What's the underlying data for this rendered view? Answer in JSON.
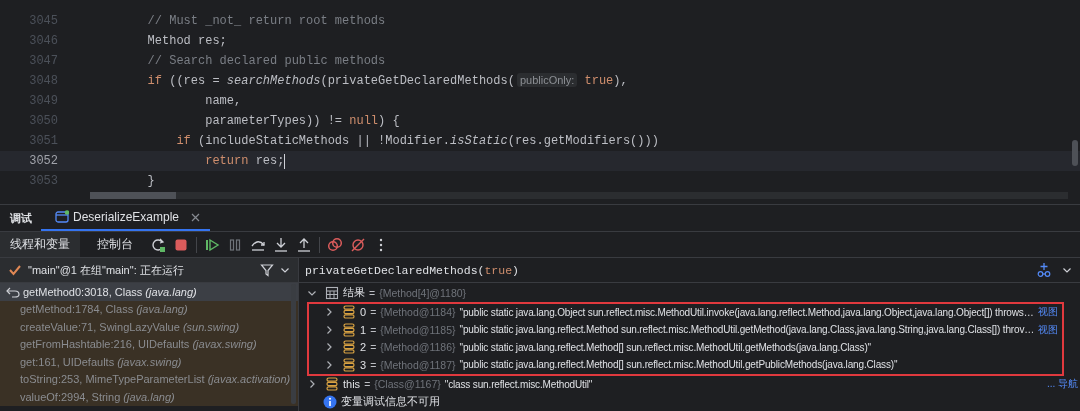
{
  "editor": {
    "lines": [
      {
        "number": "3045",
        "current": false,
        "tokens": [
          {
            "kind": "comment",
            "text": "        // Must _not_ return root methods"
          }
        ]
      },
      {
        "number": "3046",
        "current": false,
        "tokens": [
          {
            "kind": "plain",
            "text": "        Method res;"
          }
        ]
      },
      {
        "number": "3047",
        "current": false,
        "tokens": [
          {
            "kind": "comment",
            "text": "        // Search declared public methods"
          }
        ]
      },
      {
        "number": "3048",
        "current": false,
        "tokens": [
          {
            "kind": "keyword",
            "text": "        if"
          },
          {
            "kind": "plain",
            "text": " ((res = "
          },
          {
            "kind": "italic",
            "text": "searchMethods"
          },
          {
            "kind": "plain",
            "text": "(privateGetDeclaredMethods("
          },
          {
            "kind": "hint",
            "text": "publicOnly:"
          },
          {
            "kind": "keyword",
            "text": " true"
          },
          {
            "kind": "plain",
            "text": "),"
          }
        ]
      },
      {
        "number": "3049",
        "current": false,
        "tokens": [
          {
            "kind": "plain",
            "text": "                name,"
          }
        ]
      },
      {
        "number": "3050",
        "current": false,
        "tokens": [
          {
            "kind": "plain",
            "text": "                parameterTypes)) != "
          },
          {
            "kind": "keyword",
            "text": "null"
          },
          {
            "kind": "plain",
            "text": ") {"
          }
        ]
      },
      {
        "number": "3051",
        "current": false,
        "tokens": [
          {
            "kind": "keyword",
            "text": "            if"
          },
          {
            "kind": "plain",
            "text": " (includeStaticMethods || !Modifier."
          },
          {
            "kind": "italic",
            "text": "isStatic"
          },
          {
            "kind": "plain",
            "text": "(res.getModifiers()))"
          }
        ]
      },
      {
        "number": "3052",
        "current": true,
        "tokens": [
          {
            "kind": "keyword",
            "text": "                return"
          },
          {
            "kind": "plain",
            "text": " res;"
          }
        ]
      },
      {
        "number": "3053",
        "current": false,
        "tokens": [
          {
            "kind": "plain",
            "text": "        }"
          }
        ]
      }
    ]
  },
  "debug_window": {
    "title": "调试",
    "tabs": [
      {
        "label": "DeserializeExample",
        "selected": true,
        "closable": true
      }
    ]
  },
  "debugger_tabs": [
    {
      "label": "线程和变量",
      "selected": true
    },
    {
      "label": "控制台",
      "selected": false
    }
  ],
  "thread": {
    "label": "\"main\"@1 在组\"main\": 正在运行"
  },
  "frames": [
    {
      "method": "getMethod0:3018, Class",
      "package": "(java.lang)",
      "selected": true
    },
    {
      "method": "getMethod:1784, Class",
      "package": "(java.lang)",
      "selected": false
    },
    {
      "method": "createValue:71, SwingLazyValue",
      "package": "(sun.swing)",
      "selected": false
    },
    {
      "method": "getFromHashtable:216, UIDefaults",
      "package": "(javax.swing)",
      "selected": false
    },
    {
      "method": "get:161, UIDefaults",
      "package": "(javax.swing)",
      "selected": false
    },
    {
      "method": "toString:253, MimeTypeParameterList",
      "package": "(javax.activation)",
      "selected": false
    },
    {
      "method": "valueOf:2994, String",
      "package": "(java.lang)",
      "selected": false
    }
  ],
  "expression": [
    {
      "kind": "plain",
      "text": "privateGetDeclaredMethods("
    },
    {
      "kind": "keyword",
      "text": "true"
    },
    {
      "kind": "plain",
      "text": ")"
    }
  ],
  "variables": [
    {
      "kind": "array",
      "expanded": true,
      "name": "结果",
      "operator": "=",
      "type": "{Method[4]@1180}",
      "children": [
        {
          "kind": "field",
          "expanded": false,
          "highlighted": true,
          "name": "0",
          "operator": "=",
          "type": "{Method@1184}",
          "value": "\"public static java.lang.Object sun.reflect.misc.MethodUtil.invoke(java.lang.reflect.Method,java.lang.Object,java.lang.Object[]) throws…",
          "link": "视图"
        },
        {
          "kind": "field",
          "expanded": false,
          "highlighted": true,
          "name": "1",
          "operator": "=",
          "type": "{Method@1185}",
          "value": "\"public static java.lang.reflect.Method sun.reflect.misc.MethodUtil.getMethod(java.lang.Class,java.lang.String,java.lang.Class[]) throv…",
          "link": "视图"
        },
        {
          "kind": "field",
          "expanded": false,
          "highlighted": true,
          "name": "2",
          "operator": "=",
          "type": "{Method@1186}",
          "value": "\"public static java.lang.reflect.Method[] sun.reflect.misc.MethodUtil.getMethods(java.lang.Class)\""
        },
        {
          "kind": "field",
          "expanded": false,
          "highlighted": true,
          "name": "3",
          "operator": "=",
          "type": "{Method@1187}",
          "value": "\"public static java.lang.reflect.Method[] sun.reflect.misc.MethodUtil.getPublicMethods(java.lang.Class)\""
        }
      ]
    },
    {
      "kind": "field",
      "expanded": false,
      "name": "this",
      "operator": "=",
      "type": "{Class@1167}",
      "value": "\"class sun.reflect.misc.MethodUtil\"",
      "link": "... 导航"
    },
    {
      "kind": "info",
      "name": "变量调试信息不可用"
    }
  ]
}
